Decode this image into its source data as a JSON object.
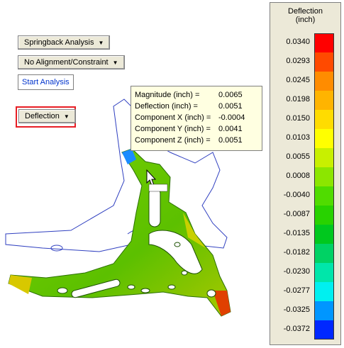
{
  "toolbar": {
    "analysis_type": "Springback Analysis",
    "alignment": "No Alignment/Constraint",
    "start_analysis": "Start Analysis",
    "display_mode": "Deflection"
  },
  "tooltip": {
    "rows": [
      {
        "label": "Magnitude (inch) =",
        "value": "0.0065"
      },
      {
        "label": "Deflection (inch) =",
        "value": "0.0051"
      },
      {
        "label": "Component X (inch) =",
        "value": "-0.0004"
      },
      {
        "label": "Component Y (inch) =",
        "value": "0.0041"
      },
      {
        "label": "Component Z (inch) =",
        "value": "0.0051"
      }
    ]
  },
  "legend": {
    "title_line1": "Deflection",
    "title_line2": "(inch)",
    "entries": [
      {
        "value": "0.0340",
        "color": "#ff0000"
      },
      {
        "value": "0.0293",
        "color": "#ff4a00"
      },
      {
        "value": "0.0245",
        "color": "#ff8c00"
      },
      {
        "value": "0.0198",
        "color": "#ffb400"
      },
      {
        "value": "0.0150",
        "color": "#ffdc00"
      },
      {
        "value": "0.0103",
        "color": "#ffff00"
      },
      {
        "value": "0.0055",
        "color": "#c8f000"
      },
      {
        "value": "0.0008",
        "color": "#8ce600"
      },
      {
        "value": "-0.0040",
        "color": "#50dc00"
      },
      {
        "value": "-0.0087",
        "color": "#28d200"
      },
      {
        "value": "-0.0135",
        "color": "#00c81e"
      },
      {
        "value": "-0.0182",
        "color": "#00d264"
      },
      {
        "value": "-0.0230",
        "color": "#00e6aa"
      },
      {
        "value": "-0.0277",
        "color": "#00f0f0"
      },
      {
        "value": "-0.0325",
        "color": "#0096ff"
      },
      {
        "value": "-0.0372",
        "color": "#0028ff"
      }
    ]
  }
}
